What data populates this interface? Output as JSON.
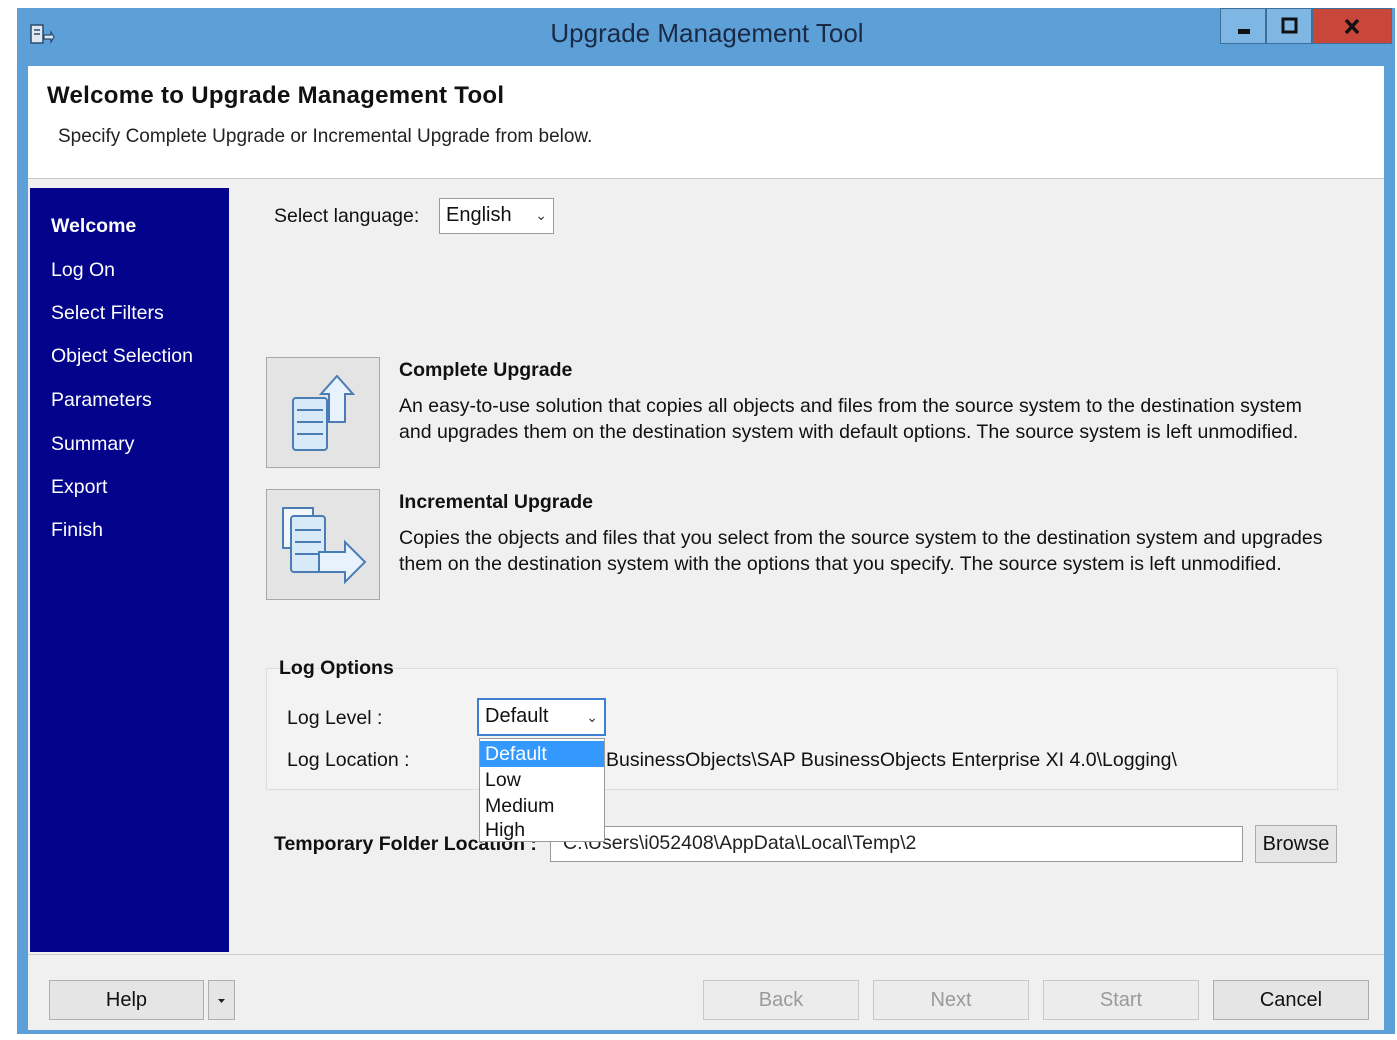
{
  "window": {
    "title": "Upgrade Management Tool",
    "controls": {
      "minimize": "▬",
      "maximize": "◻",
      "close": "x"
    }
  },
  "header": {
    "title": "Welcome to Upgrade Management Tool",
    "subtitle": "Specify Complete Upgrade or Incremental Upgrade from below."
  },
  "sidebar": {
    "items": [
      {
        "label": "Welcome",
        "active": true
      },
      {
        "label": "Log On"
      },
      {
        "label": "Select Filters"
      },
      {
        "label": "Object Selection"
      },
      {
        "label": "Parameters"
      },
      {
        "label": "Summary"
      },
      {
        "label": "Export"
      },
      {
        "label": "Finish"
      }
    ]
  },
  "language": {
    "label": "Select language:",
    "value": "English"
  },
  "options": [
    {
      "title": "Complete Upgrade",
      "description": "An easy-to-use solution that copies all objects and files from the source system to the destination system and upgrades them on the destination system with default options.  The source system is left unmodified.",
      "icon": "server-upload-icon"
    },
    {
      "title": "Incremental Upgrade",
      "description": "Copies the objects and files that you select from the source system to the destination system and upgrades them on the destination system with the options that you specify.  The source system is left unmodified.",
      "icon": "documents-arrow-icon"
    }
  ],
  "log_options": {
    "heading": "Log Options",
    "level_label": "Log Level :",
    "level_value": "Default",
    "level_options": [
      "Default",
      "Low",
      "Medium",
      "High"
    ],
    "location_label": "Log Location :",
    "location_value_visible": "BusinessObjects\\SAP BusinessObjects Enterprise XI 4.0\\Logging\\"
  },
  "temp_folder": {
    "label": "Temporary Folder Location :",
    "value_visible": "C:\\Users\\i052408\\AppData\\Local\\Temp\\2",
    "browse_label": "Browse"
  },
  "footer": {
    "help_label": "Help",
    "back_label": "Back",
    "next_label": "Next",
    "start_label": "Start",
    "cancel_label": "Cancel"
  }
}
